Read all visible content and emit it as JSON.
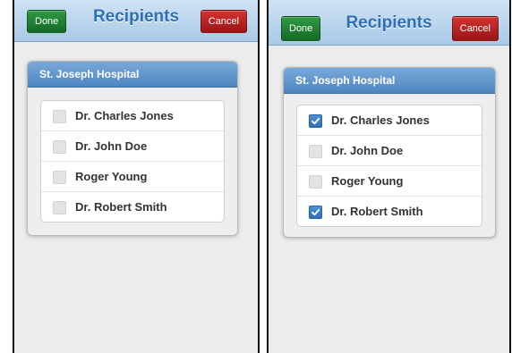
{
  "screens": [
    {
      "navbar": {
        "title": "Recipients",
        "done_label": "Done",
        "cancel_label": "Cancel"
      },
      "group": {
        "header": "St. Joseph Hospital",
        "items": [
          {
            "label": "Dr. Charles Jones",
            "checked": false
          },
          {
            "label": "Dr. John Doe",
            "checked": false
          },
          {
            "label": "Roger Young",
            "checked": false
          },
          {
            "label": "Dr. Robert Smith",
            "checked": false
          }
        ]
      }
    },
    {
      "navbar": {
        "title": "Recipients",
        "done_label": "Done",
        "cancel_label": "Cancel"
      },
      "group": {
        "header": "St. Joseph Hospital",
        "items": [
          {
            "label": "Dr. Charles Jones",
            "checked": true
          },
          {
            "label": "Dr. John Doe",
            "checked": false
          },
          {
            "label": "Roger Young",
            "checked": false
          },
          {
            "label": "Dr. Robert Smith",
            "checked": true
          }
        ]
      }
    }
  ],
  "colors": {
    "title": "#2f6fb3",
    "done_button": "#1f7f33",
    "cancel_button": "#b51f1f",
    "group_header": "#5b90c8",
    "checkbox_checked": "#3a7cc6"
  },
  "icons": {
    "check": "checkmark-icon"
  }
}
